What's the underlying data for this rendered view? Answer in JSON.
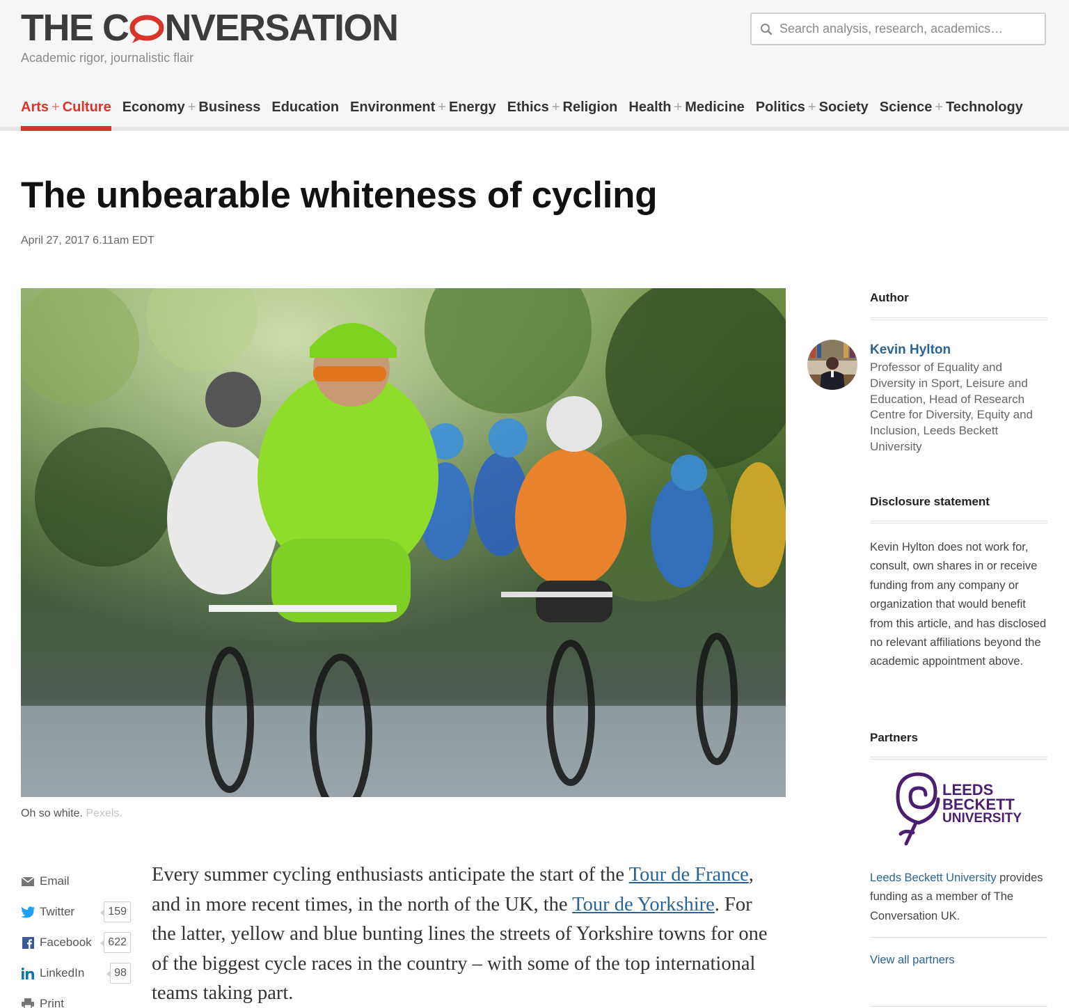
{
  "header": {
    "logo_left": "THE C",
    "logo_right": "NVERSATION",
    "tagline": "Academic rigor, journalistic flair",
    "search_placeholder": "Search analysis, research, academics…"
  },
  "nav": [
    {
      "a": "Arts",
      "b": "Culture",
      "active": true
    },
    {
      "a": "Economy",
      "b": "Business"
    },
    {
      "a": "Education",
      "b": ""
    },
    {
      "a": "Environment",
      "b": "Energy"
    },
    {
      "a": "Ethics",
      "b": "Religion"
    },
    {
      "a": "Health",
      "b": "Medicine"
    },
    {
      "a": "Politics",
      "b": "Society"
    },
    {
      "a": "Science",
      "b": "Technology"
    }
  ],
  "nav_plus": "+",
  "article": {
    "title": "The unbearable whiteness of cycling",
    "date": "April 27, 2017 6.11am EDT",
    "caption": "Oh so white.",
    "caption_credit": "Pexels.",
    "body_1": "Every summer cycling enthusiasts anticipate the start of the ",
    "link_1": "Tour de France",
    "body_2": ", and in more recent times, in the north of the UK, the ",
    "link_2": "Tour de Yorkshire",
    "body_3": ". For the latter, yellow and blue bunting lines the streets of Yorkshire towns for one of the biggest cycle races in the country – with some of the top international teams taking part."
  },
  "share": {
    "email": "Email",
    "twitter": "Twitter",
    "twitter_count": "159",
    "facebook": "Facebook",
    "facebook_count": "622",
    "linkedin": "LinkedIn",
    "linkedin_count": "98",
    "print": "Print"
  },
  "sidebar": {
    "author_heading": "Author",
    "author_name": "Kevin Hylton",
    "author_role": "Professor of Equality and Diversity in Sport, Leisure and Education, Head of Research Centre for Diversity, Equity and Inclusion, Leeds Beckett University",
    "disclosure_heading": "Disclosure statement",
    "disclosure_text": "Kevin Hylton does not work for, consult, own shares in or receive funding from any company or organization that would benefit from this article, and has disclosed no relevant affiliations beyond the academic appointment above.",
    "partners_heading": "Partners",
    "partner_logo_line1": "LEEDS",
    "partner_logo_line2": "BECKETT",
    "partner_logo_line3": "UNIVERSITY",
    "partner_link": "Leeds Beckett University",
    "partner_text": " provides funding as a member of The Conversation UK.",
    "view_all": "View all partners"
  },
  "colors": {
    "accent": "#d8352a",
    "link": "#2a6496",
    "partner_purple": "#4b1f6f"
  }
}
